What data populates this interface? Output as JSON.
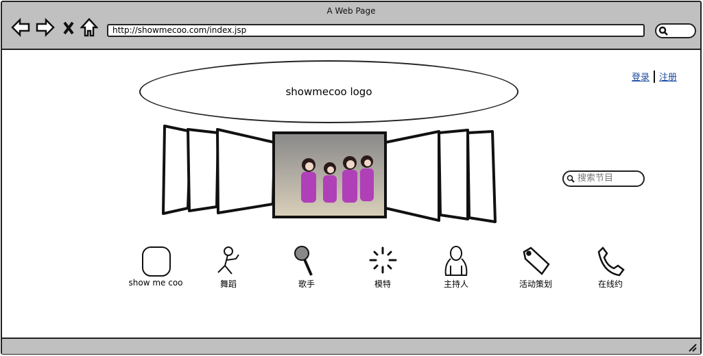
{
  "browser": {
    "title": "A Web Page",
    "url": "http://showmecoo.com/index.jsp"
  },
  "header": {
    "logo": "showmecoo logo",
    "login": "登录",
    "register": "注册"
  },
  "search": {
    "placeholder": "搜索节目"
  },
  "categories": [
    {
      "label": "show me coo",
      "icon": "rounded-square-icon"
    },
    {
      "label": "舞蹈",
      "icon": "running-person-icon"
    },
    {
      "label": "歌手",
      "icon": "microphone-icon"
    },
    {
      "label": "模特",
      "icon": "sparkle-icon"
    },
    {
      "label": "主持人",
      "icon": "person-icon"
    },
    {
      "label": "活动策划",
      "icon": "tag-icon"
    },
    {
      "label": "在线约",
      "icon": "phone-icon"
    }
  ]
}
